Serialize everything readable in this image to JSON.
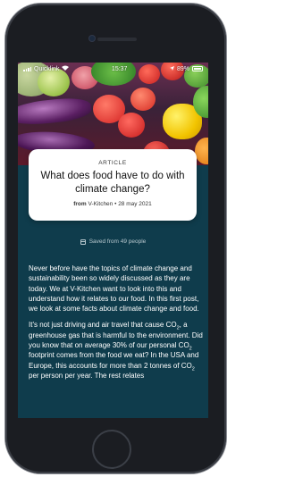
{
  "status_bar": {
    "carrier": "Quicklink",
    "time": "15:37",
    "battery": "89%",
    "icons": [
      "signal-icon",
      "wifi-icon",
      "location-icon",
      "battery-icon"
    ]
  },
  "article": {
    "tag": "ARTICLE",
    "title": "What does food have to do with climate change?",
    "from_label": "from",
    "author": "V-Kitchen",
    "date": "• 28 may 2021"
  },
  "saved": {
    "text": "Saved from 49 people",
    "icon": "calendar-icon"
  },
  "paragraphs": {
    "p1": "Never before have the topics of climate change and sustainability been so widely discussed as they are today. We at V-Kitchen want to look into this and understand how it relates to our food. In this first post, we look at some facts about climate change and food.",
    "p2a": "It's not just driving and air travel that cause CO",
    "p2b": ", a greenhouse gas that is harmful to the environment. Did you know that on average 30% of our personal CO",
    "p2c": " footprint comes from the food we eat? In the USA and Europe, this accounts for more than 2 tonnes of CO",
    "p2d": " per person per year. The rest relates",
    "sub": "2"
  },
  "colors": {
    "screen_bg": "#0f3c4c",
    "card_bg": "#ffffff",
    "phone_frame": "#1b1d22"
  }
}
